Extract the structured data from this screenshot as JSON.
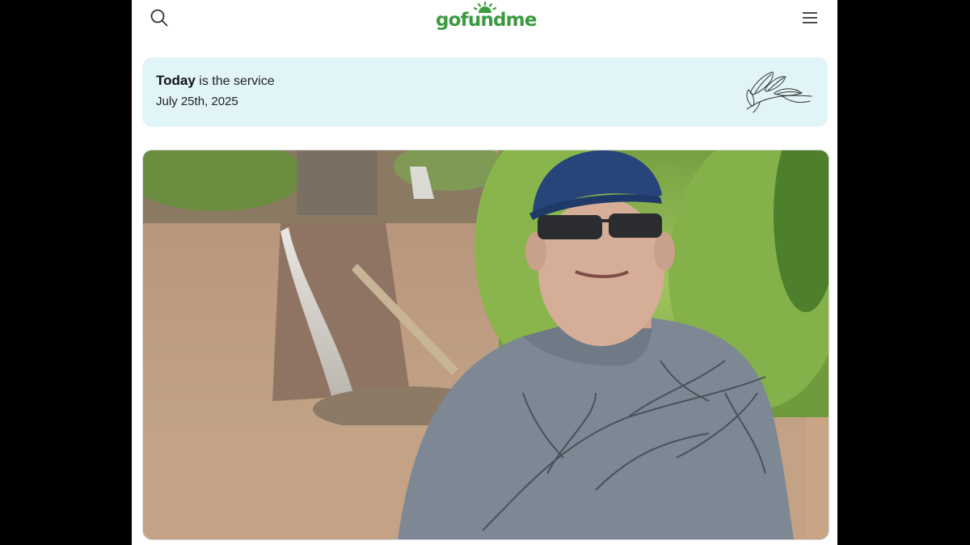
{
  "header": {
    "logo_text": "gofundme",
    "search_icon": "search-icon",
    "menu_icon": "hamburger-menu-icon"
  },
  "banner": {
    "bold": "Today",
    "rest": " is the service",
    "date": "July 25th, 2025",
    "icon": "leaf-branch-icon"
  },
  "colors": {
    "brand_green": "#3a9a3f",
    "banner_bg": "#e1f4f7",
    "outside_bg": "#000000"
  }
}
